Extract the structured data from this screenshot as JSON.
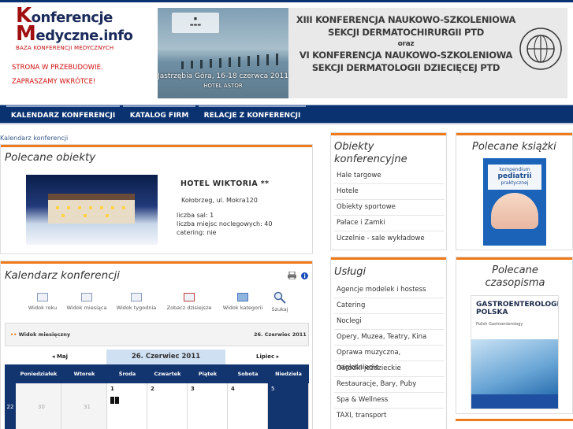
{
  "header": {
    "logo_line1": "Konferencje",
    "logo_line2": "Medyczne.info",
    "logo_tagline": "BAZA KONFERENCJI MEDYCZNYCH",
    "notice_line1": "STRONA W PRZEBUDOWIE.",
    "notice_line2": "ZAPRASZAMY WKRÓTCE!"
  },
  "banner": {
    "line1": "XIII KONFERENCJA NAUKOWO-SZKOLENIOWA",
    "line2": "SEKCJI DERMATOCHIRURGII PTD",
    "line3": "oraz",
    "line4": "VI KONFERENCJA NAUKOWO-SZKOLENIOWA",
    "line5": "SEKCJI DERMATOLOGII DZIECIĘCEJ PTD",
    "photo_caption": "Jastrzębia Góra, 16-18 czerwca 2011",
    "photo_venue": "HOTEL ASTOR"
  },
  "nav": {
    "items": [
      {
        "label": "KALENDARZ KONFERENCJI"
      },
      {
        "label": "KATALOG FIRM"
      },
      {
        "label": "RELACJE Z KONFERENCJI"
      }
    ]
  },
  "breadcrumb": "Kalendarz konferencji",
  "featured": {
    "title": "Polecane obiekty",
    "hotel_name": "HOTEL WIKTORIA **",
    "hotel_address": "Kołobrzeg, ul. Mokra120",
    "rooms": "liczba sal: 1",
    "beds": "liczba miejsc noclegowych: 40",
    "catering": "catering: nie"
  },
  "calendar": {
    "title": "Kalendarz konferencji",
    "tools": [
      {
        "label": "Widok roku",
        "icon": "calendar-year-icon"
      },
      {
        "label": "Widok miesiąca",
        "icon": "calendar-month-icon"
      },
      {
        "label": "Widok tygodnia",
        "icon": "calendar-week-icon"
      },
      {
        "label": "Zobacz dzisiejsze",
        "icon": "calendar-today-icon"
      },
      {
        "label": "Widok kategorii",
        "icon": "folder-icon"
      },
      {
        "label": "Szukaj",
        "icon": "search-icon"
      }
    ],
    "view_label": "Widok miesięczny",
    "date_label": "26. Czerwiec 2011",
    "prev_month": "Maj",
    "current": "26. Czerwiec 2011",
    "next_month": "Lipiec",
    "weekdays": [
      "Poniedziałek",
      "Wtorek",
      "Środa",
      "Czwartek",
      "Piątek",
      "Sobota",
      "Niedziela"
    ],
    "week_number": "22",
    "first_row": [
      "30",
      "31",
      "1",
      "2",
      "3",
      "4",
      "5"
    ]
  },
  "sidebar_objects": {
    "title": "Obiekty konferencyjne",
    "items": [
      {
        "label": "Hale targowe"
      },
      {
        "label": "Hotele"
      },
      {
        "label": "Obiekty sportowe"
      },
      {
        "label": "Pałace i Zamki"
      },
      {
        "label": "Uczelnie - sale wykładowe"
      }
    ]
  },
  "sidebar_services": {
    "title": "Usługi",
    "items": [
      {
        "label": "Agencje modelek i hostess"
      },
      {
        "label": "Catering"
      },
      {
        "label": "Noclegi"
      },
      {
        "label": "Opery, Muzea, Teatry, Kina"
      },
      {
        "label": "Oprawa muzyczna, nagłośnienie"
      },
      {
        "label": "Ośrodki jeździeckie"
      },
      {
        "label": "Restauracje, Bary, Puby"
      },
      {
        "label": "Spa & Wellness"
      },
      {
        "label": "TAXI, transport"
      }
    ]
  },
  "books": {
    "title": "Polecane książki",
    "cover_line1": "kompendium",
    "cover_line2": "pediatrii",
    "cover_line3": "praktycznej"
  },
  "magazines": {
    "title_line1": "Polecane",
    "title_line2": "czasopisma",
    "cover_title1": "GASTROENTEROLOGIA",
    "cover_title2": "POLSKA",
    "cover_sub": "Polish Gastroenterology"
  },
  "colors": {
    "navy": "#0a3270",
    "accent_orange": "#f07a1a",
    "notice_red": "#d01010"
  }
}
